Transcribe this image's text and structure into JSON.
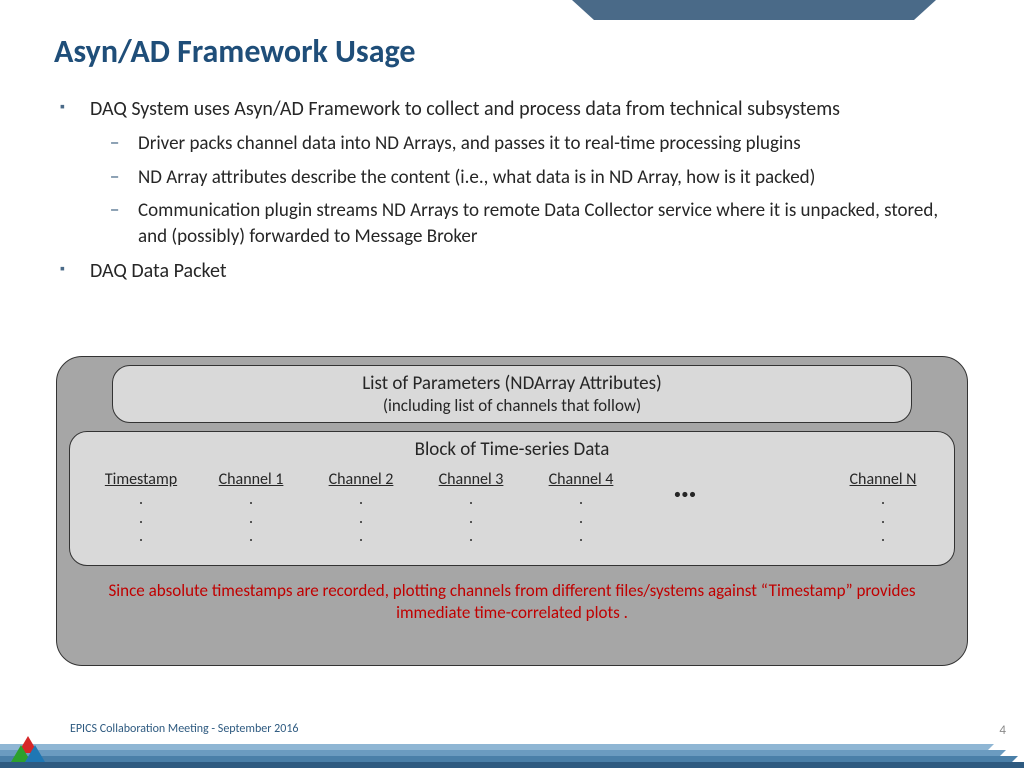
{
  "title": "Asyn/AD Framework Usage",
  "bullets": {
    "b1": "DAQ System uses Asyn/AD Framework to collect and process data from technical subsystems",
    "b1_subs": {
      "s1": "Driver packs channel data into ND Arrays, and passes it to real-time processing plugins",
      "s2": "ND Array attributes describe the content (i.e., what data is in ND Array, how is it packed)",
      "s3": "Communication plugin streams ND Arrays to remote Data Collector service where it is unpacked, stored, and (possibly) forwarded to Message Broker"
    },
    "b2": "DAQ Data Packet"
  },
  "packet": {
    "params_title": "List of Parameters (NDArray Attributes)",
    "params_sub": "(including list of channels that follow)",
    "ts_title": "Block of Time-series Data",
    "columns": {
      "ts": "Timestamp",
      "c1": "Channel 1",
      "c2": "Channel 2",
      "c3": "Channel 3",
      "c4": "Channel 4",
      "ellipsis": "…",
      "cn": "Channel N"
    },
    "dot": ".",
    "note": "Since absolute timestamps are recorded, plotting channels from different files/systems against “Timestamp” provides immediate time-correlated plots ."
  },
  "footer": "EPICS Collaboration Meeting  - September 2016",
  "page": "4"
}
